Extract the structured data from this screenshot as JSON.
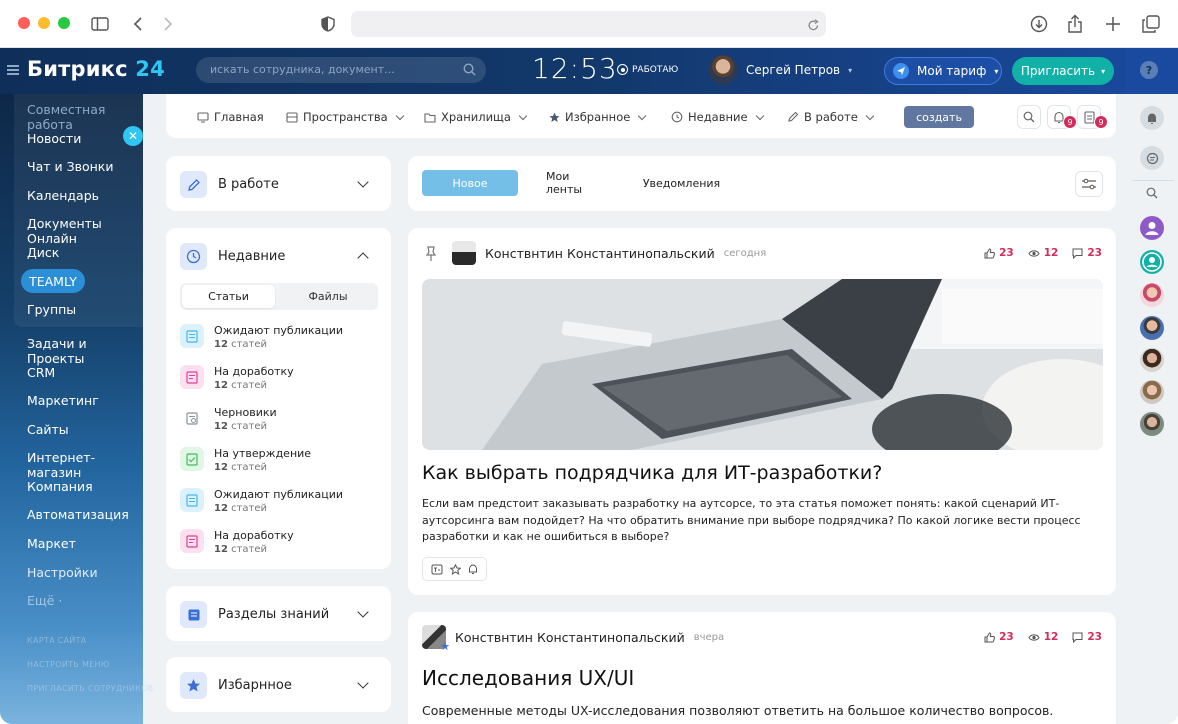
{
  "browser": {
    "url": ""
  },
  "header": {
    "logo_main": "Битрикс",
    "logo_num": "24",
    "search_placeholder": "искать сотрудника, документ...",
    "clock": "12:53",
    "work_status": "РАБОТАЮ",
    "user_name": "Сергей Петров",
    "tariff_label": "Мой тариф",
    "invite_label": "Пригласить",
    "help_label": "?"
  },
  "sidebar": {
    "items": [
      {
        "label": "Совместная работа"
      },
      {
        "label": "Новости"
      },
      {
        "label": "Чат и Звонки"
      },
      {
        "label": "Календарь"
      },
      {
        "label": "Документы Онлайн"
      },
      {
        "label": "Диск"
      },
      {
        "label": "TEAMLY"
      },
      {
        "label": "Группы"
      },
      {
        "label": "Задачи и Проекты"
      },
      {
        "label": "CRM"
      },
      {
        "label": "Маркетинг"
      },
      {
        "label": "Сайты"
      },
      {
        "label": "Интернет-магазин"
      },
      {
        "label": "Компания"
      },
      {
        "label": "Автоматизация"
      },
      {
        "label": "Маркет"
      },
      {
        "label": "Настройки"
      },
      {
        "label": "Ещё ·"
      }
    ],
    "footer": [
      "КАРТА САЙТА",
      "НАСТРОИТЬ МЕНЮ",
      "ПРИГЛАСИТЬ СОТРУДНИКОВ"
    ]
  },
  "topnav": {
    "items": [
      {
        "label": "Главная"
      },
      {
        "label": "Пространства"
      },
      {
        "label": "Хранилища"
      },
      {
        "label": "Избранное"
      },
      {
        "label": "Недавние"
      },
      {
        "label": "В работе"
      }
    ],
    "create_label": "создать",
    "notif_badge": "9",
    "tasks_badge": "9"
  },
  "left_panels": {
    "in_work": {
      "title": "В работе"
    },
    "recent": {
      "title": "Недавние",
      "tabs": [
        "Статьи",
        "Файлы"
      ],
      "items": [
        {
          "title": "Ожидают публикации",
          "count": "12",
          "unit": "статей",
          "color": "#3fb8f0"
        },
        {
          "title": "На доработку",
          "count": "12",
          "unit": "статей",
          "color": "#e63c94"
        },
        {
          "title": "Черновики",
          "count": "12",
          "unit": "статей",
          "color": "#8a949c"
        },
        {
          "title": "На утверждение",
          "count": "12",
          "unit": "статей",
          "color": "#3fbf5a"
        },
        {
          "title": "Ожидают публикации",
          "count": "12",
          "unit": "статей",
          "color": "#3fb8f0"
        },
        {
          "title": "На доработку",
          "count": "12",
          "unit": "статей",
          "color": "#e63c94"
        }
      ]
    },
    "knowledge": {
      "title": "Разделы знаний"
    },
    "favorites": {
      "title": "Избарнное"
    }
  },
  "feed": {
    "tabs": [
      "Новое",
      "Мои ленты",
      "Уведомления"
    ],
    "posts": [
      {
        "author": "Конствнтин Константинопальский",
        "when": "сегодня",
        "likes": "23",
        "views": "12",
        "comments": "23",
        "title": "Как выбрать подрядчика для ИТ-разработки?",
        "text": "Если вам предстоит заказывать разработку на аутсорсе, то эта статья поможет понять: какой сценарий ИТ-аутсорсинга вам подойдет? На что обратить внимание при выборе подрядчика? По какой логике вести процесс разработки и как не ошибиться в выборе?"
      },
      {
        "author": "Конствнтин Константинопальский",
        "when": "вчера",
        "likes": "23",
        "views": "12",
        "comments": "23",
        "title": "Исследования UX/UI",
        "text": "Современные методы UX-исследования позволяют ответить на большое количество вопросов."
      }
    ]
  },
  "colors": {
    "accent": "#2fc6f6",
    "badge": "#d32c5a",
    "invite": "#12b1a8",
    "active_tab": "#74bfe8"
  }
}
